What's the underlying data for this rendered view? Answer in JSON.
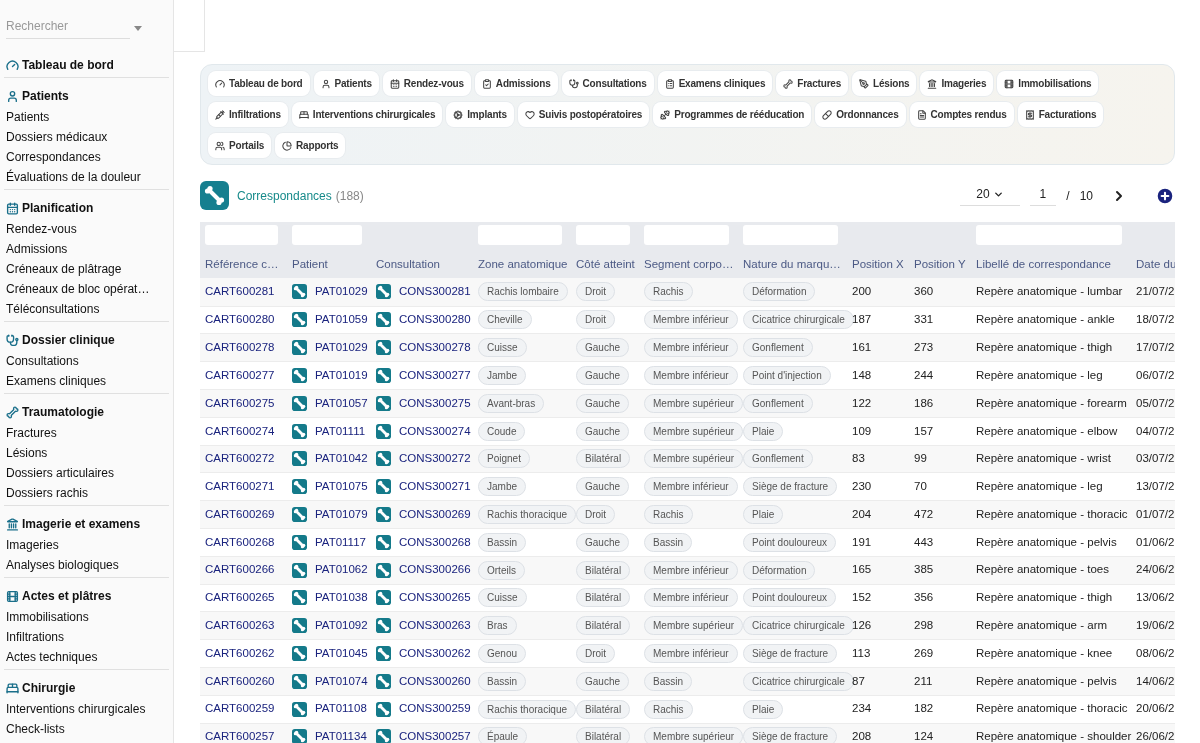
{
  "sidebar": {
    "search": {
      "placeholder": "Rechercher"
    },
    "groups": [
      {
        "title": "Tableau de bord"
      },
      {
        "title": "Patients",
        "items": [
          "Patients",
          "Dossiers médicaux",
          "Correspondances",
          "Évaluations de la douleur"
        ]
      },
      {
        "title": "Planification",
        "items": [
          "Rendez-vous",
          "Admissions",
          "Créneaux de plâtrage",
          "Créneaux de bloc opérat…",
          "Téléconsultations"
        ]
      },
      {
        "title": "Dossier clinique",
        "items": [
          "Consultations",
          "Examens cliniques"
        ]
      },
      {
        "title": "Traumatologie",
        "items": [
          "Fractures",
          "Lésions",
          "Dossiers articulaires",
          "Dossiers rachis"
        ]
      },
      {
        "title": "Imagerie et examens",
        "items": [
          "Imageries",
          "Analyses biologiques"
        ]
      },
      {
        "title": "Actes et plâtres",
        "items": [
          "Immobilisations",
          "Infiltrations",
          "Actes techniques"
        ]
      },
      {
        "title": "Chirurgie",
        "items": [
          "Interventions chirurgicales",
          "Check-lists"
        ]
      }
    ]
  },
  "nav_chips": [
    "Tableau de bord",
    "Patients",
    "Rendez-vous",
    "Admissions",
    "Consultations",
    "Examens cliniques",
    "Fractures",
    "Lésions",
    "Imageries",
    "Immobilisations",
    "Infiltrations",
    "Interventions chirurgicales",
    "Implants",
    "Suivis postopératoires",
    "Programmes de rééducation",
    "Ordonnances",
    "Comptes rendus",
    "Facturations",
    "Portails",
    "Rapports"
  ],
  "page": {
    "title": "Correspondances",
    "count": "(188)"
  },
  "pagination": {
    "page_size": "20",
    "page": "1",
    "separator": "/",
    "total_pages": "10"
  },
  "table": {
    "columns": [
      {
        "label": "Référence c…",
        "kind": "link",
        "filter": true
      },
      {
        "label": "Patient",
        "kind": "icon-link",
        "filter": true
      },
      {
        "label": "Consultation",
        "kind": "icon-link",
        "filter": false
      },
      {
        "label": "Zone anatomique",
        "kind": "pill",
        "filter": true
      },
      {
        "label": "Côté atteint",
        "kind": "pill",
        "filter": true
      },
      {
        "label": "Segment corpo…",
        "kind": "pill",
        "filter": true
      },
      {
        "label": "Nature du marqu…",
        "kind": "pill",
        "filter": true
      },
      {
        "label": "Position X",
        "kind": "text",
        "filter": false
      },
      {
        "label": "Position Y",
        "kind": "text",
        "filter": false
      },
      {
        "label": "Libellé de correspondance",
        "kind": "text",
        "filter": true
      },
      {
        "label": "Date du",
        "kind": "text",
        "filter": false
      }
    ],
    "rows": [
      [
        "CART600281",
        "PAT01029",
        "CONS300281",
        "Rachis lombaire",
        "Droit",
        "Rachis",
        "Déformation",
        "200",
        "360",
        "Repère anatomique - lumbar",
        "21/07/2"
      ],
      [
        "CART600280",
        "PAT01059",
        "CONS300280",
        "Cheville",
        "Droit",
        "Membre inférieur",
        "Cicatrice chirurgicale",
        "187",
        "331",
        "Repère anatomique - ankle",
        "18/07/2"
      ],
      [
        "CART600278",
        "PAT01029",
        "CONS300278",
        "Cuisse",
        "Gauche",
        "Membre inférieur",
        "Gonflement",
        "161",
        "273",
        "Repère anatomique - thigh",
        "17/07/2"
      ],
      [
        "CART600277",
        "PAT01019",
        "CONS300277",
        "Jambe",
        "Gauche",
        "Membre inférieur",
        "Point d'injection",
        "148",
        "244",
        "Repère anatomique - leg",
        "06/07/2"
      ],
      [
        "CART600275",
        "PAT01057",
        "CONS300275",
        "Avant-bras",
        "Gauche",
        "Membre supérieur",
        "Gonflement",
        "122",
        "186",
        "Repère anatomique - forearm",
        "05/07/2"
      ],
      [
        "CART600274",
        "PAT01111",
        "CONS300274",
        "Coude",
        "Gauche",
        "Membre supérieur",
        "Plaie",
        "109",
        "157",
        "Repère anatomique - elbow",
        "04/07/2"
      ],
      [
        "CART600272",
        "PAT01042",
        "CONS300272",
        "Poignet",
        "Bilatéral",
        "Membre supérieur",
        "Gonflement",
        "83",
        "99",
        "Repère anatomique - wrist",
        "03/07/2"
      ],
      [
        "CART600271",
        "PAT01075",
        "CONS300271",
        "Jambe",
        "Gauche",
        "Membre inférieur",
        "Siège de fracture",
        "230",
        "70",
        "Repère anatomique - leg",
        "13/07/2"
      ],
      [
        "CART600269",
        "PAT01079",
        "CONS300269",
        "Rachis thoracique",
        "Droit",
        "Rachis",
        "Plaie",
        "204",
        "472",
        "Repère anatomique - thoracic",
        "01/07/2"
      ],
      [
        "CART600268",
        "PAT01117",
        "CONS300268",
        "Bassin",
        "Gauche",
        "Bassin",
        "Point douloureux",
        "191",
        "443",
        "Repère anatomique - pelvis",
        "01/06/2"
      ],
      [
        "CART600266",
        "PAT01062",
        "CONS300266",
        "Orteils",
        "Bilatéral",
        "Membre inférieur",
        "Déformation",
        "165",
        "385",
        "Repère anatomique - toes",
        "24/06/2"
      ],
      [
        "CART600265",
        "PAT01038",
        "CONS300265",
        "Cuisse",
        "Bilatéral",
        "Membre inférieur",
        "Point douloureux",
        "152",
        "356",
        "Repère anatomique - thigh",
        "13/06/2"
      ],
      [
        "CART600263",
        "PAT01092",
        "CONS300263",
        "Bras",
        "Bilatéral",
        "Membre supérieur",
        "Cicatrice chirurgicale",
        "126",
        "298",
        "Repère anatomique - arm",
        "19/06/2"
      ],
      [
        "CART600262",
        "PAT01045",
        "CONS300262",
        "Genou",
        "Droit",
        "Membre inférieur",
        "Siège de fracture",
        "113",
        "269",
        "Repère anatomique - knee",
        "08/06/2"
      ],
      [
        "CART600260",
        "PAT01074",
        "CONS300260",
        "Bassin",
        "Gauche",
        "Bassin",
        "Cicatrice chirurgicale",
        "87",
        "211",
        "Repère anatomique - pelvis",
        "14/06/2"
      ],
      [
        "CART600259",
        "PAT01108",
        "CONS300259",
        "Rachis thoracique",
        "Bilatéral",
        "Rachis",
        "Plaie",
        "234",
        "182",
        "Repère anatomique - thoracic",
        "20/06/2"
      ],
      [
        "CART600257",
        "PAT01134",
        "CONS300257",
        "Épaule",
        "Bilatéral",
        "Membre supérieur",
        "Siège de fracture",
        "208",
        "124",
        "Repère anatomique - shoulder",
        "26/06/2"
      ]
    ]
  }
}
